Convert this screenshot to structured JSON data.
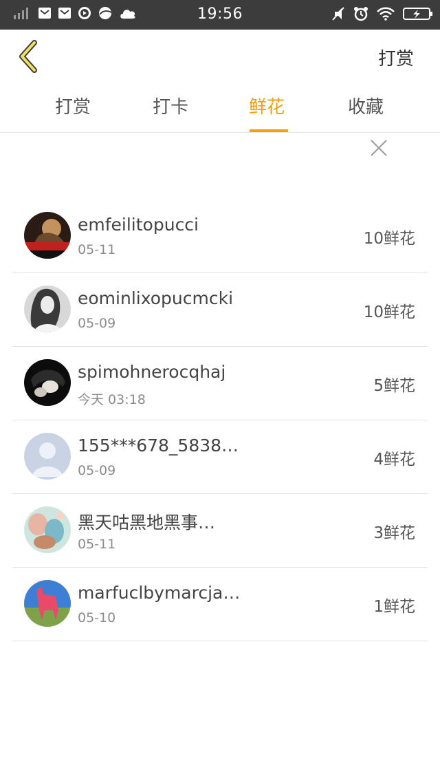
{
  "status_bar": {
    "time": "19:56",
    "left_icons": [
      "signal-icon",
      "mail-icon",
      "mail-icon",
      "play-icon",
      "ball-icon",
      "cloud-icon"
    ],
    "right_icons": [
      "mute-icon",
      "alarm-icon",
      "wifi-icon",
      "battery-icon"
    ]
  },
  "header": {
    "back_icon": "chevron-left-icon",
    "action_label": "打赏",
    "accent_color": "#f5a000"
  },
  "tabs": [
    {
      "label": "打赏",
      "active": false
    },
    {
      "label": "打卡",
      "active": false
    },
    {
      "label": "鲜花",
      "active": true
    },
    {
      "label": "收藏",
      "active": false
    }
  ],
  "close_icon": "close-icon",
  "list": [
    {
      "name": "emfeilitopucci",
      "date": "05-11",
      "amount": "10鲜花"
    },
    {
      "name": "eominlixopucmcki",
      "date": "05-09",
      "amount": "10鲜花"
    },
    {
      "name": "spimohnerocqhaj",
      "date": "今天 03:18",
      "amount": "5鲜花"
    },
    {
      "name": "155***678_5838…",
      "date": "05-09",
      "amount": "4鲜花"
    },
    {
      "name": "黑天咕黑地黑事…",
      "date": "05-11",
      "amount": "3鲜花"
    },
    {
      "name": "marfuclbymarcja…",
      "date": "05-10",
      "amount": "1鲜花"
    }
  ]
}
